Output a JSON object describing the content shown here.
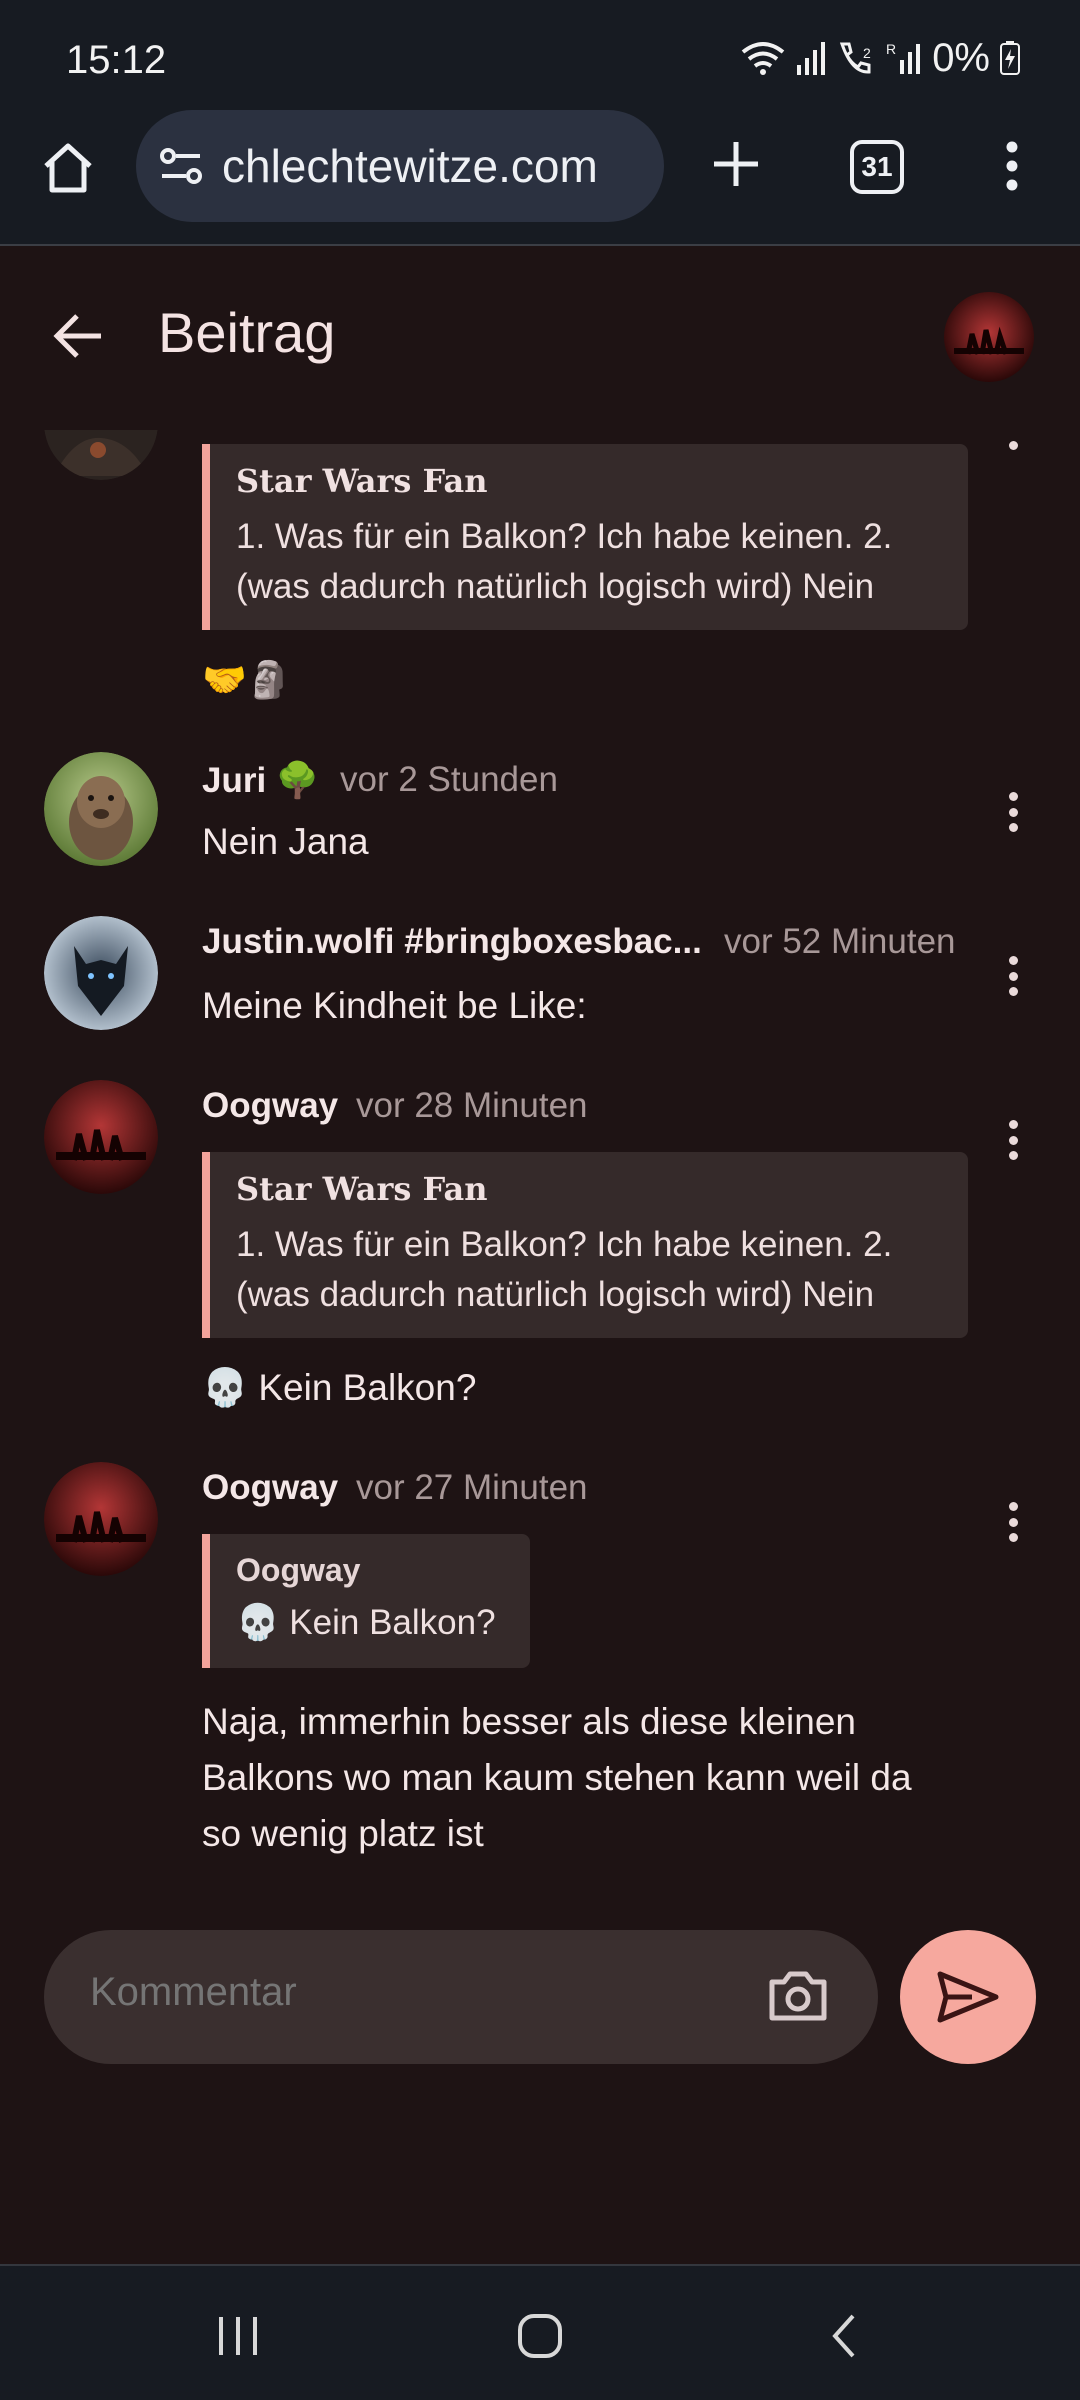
{
  "status_bar": {
    "time": "15:12",
    "battery": "0%",
    "signal_label": "R"
  },
  "browser": {
    "url": "chlechtewitze.com",
    "tab_count": "31"
  },
  "header": {
    "title": "Beitrag"
  },
  "posts": [
    {
      "quote": {
        "author": "Star Wars Fan",
        "lines": [
          "1. Was für ein Balkon? Ich habe keinen. 2.",
          "(was dadurch natürlich logisch wird) Nein"
        ]
      },
      "text": "🤝🗿"
    },
    {
      "name": "Juri 🌳",
      "time": "vor 2 Stunden",
      "text": "Nein Jana"
    },
    {
      "name": "Justin.wolfi #bringboxesbac...",
      "time": "vor 52 Minuten",
      "text": "Meine Kindheit be Like:"
    },
    {
      "name": "Oogway",
      "time": "vor 28 Minuten",
      "quote": {
        "author": "Star Wars Fan",
        "lines": [
          "1. Was für ein Balkon? Ich habe keinen. 2.",
          "(was dadurch natürlich logisch wird) Nein"
        ]
      },
      "text": "💀 Kein Balkon?"
    },
    {
      "name": "Oogway",
      "time": "vor 27 Minuten",
      "quote": {
        "author": "Oogway",
        "lines": [
          "💀 Kein Balkon?"
        ]
      },
      "text_lines": [
        "Naja, immerhin besser als diese kleinen",
        "Balkons wo man kaum stehen kann weil da",
        "so wenig platz ist"
      ]
    }
  ],
  "comment": {
    "placeholder": "Kommentar"
  },
  "colors": {
    "background": "#1e1314",
    "accent": "#f6a89e",
    "quote_bg": "#352a2a",
    "bar_bg": "#171b22"
  }
}
